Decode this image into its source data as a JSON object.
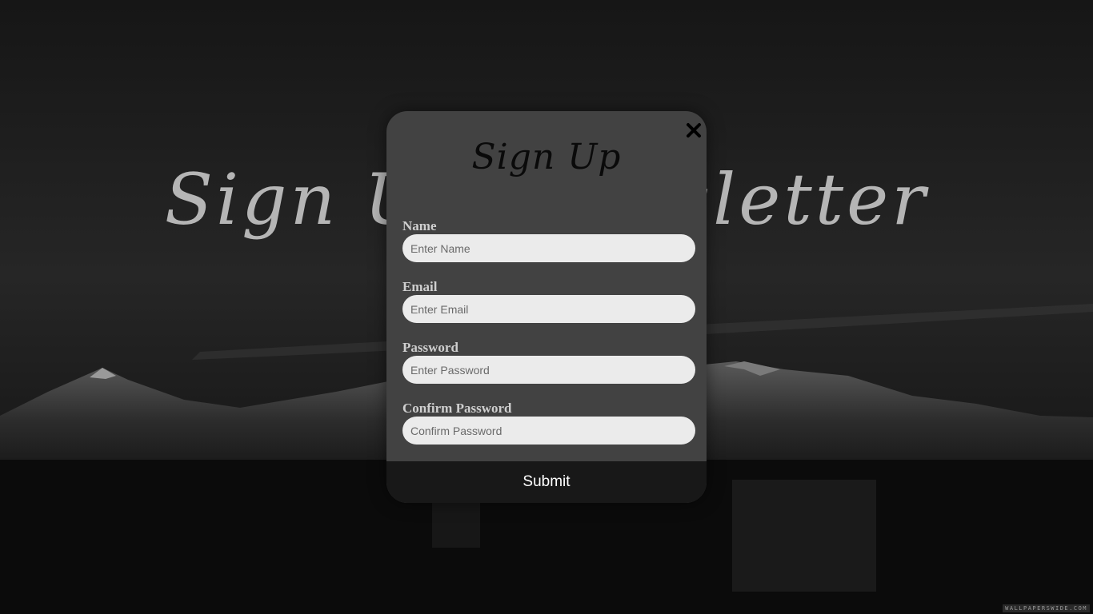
{
  "background": {
    "title": "Sign Up Newsletter",
    "watermark": "WALLPAPERSWIDE.COM"
  },
  "modal": {
    "title": "Sign Up",
    "close_icon": "close-icon",
    "fields": [
      {
        "label": "Name",
        "placeholder": "Enter Name",
        "value": ""
      },
      {
        "label": "Email",
        "placeholder": "Enter Email",
        "value": ""
      },
      {
        "label": "Password",
        "placeholder": "Enter Password",
        "value": ""
      },
      {
        "label": "Confirm Password",
        "placeholder": "Confirm Password",
        "value": ""
      }
    ],
    "submit_label": "Submit"
  },
  "colors": {
    "modal_bg": "#424242",
    "submit_bg": "#181818",
    "input_bg": "#ebebeb",
    "label_text": "#cfcfcf"
  }
}
